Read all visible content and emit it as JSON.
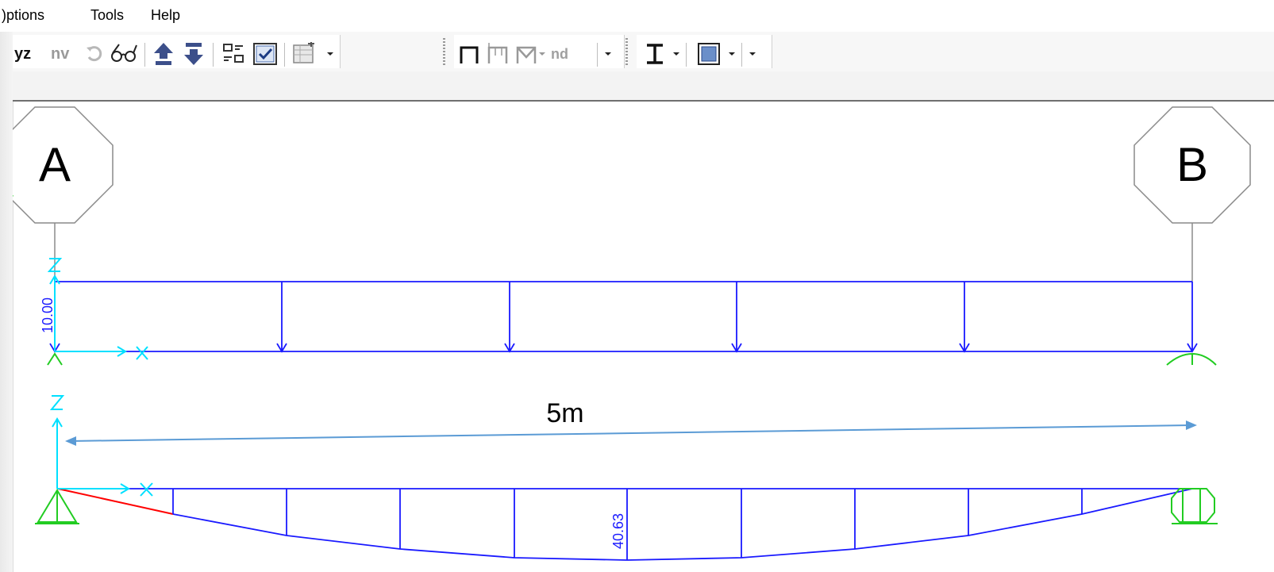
{
  "menu": {
    "options": ")ptions",
    "tools": "Tools",
    "help": "Help"
  },
  "toolbar": {
    "yz_label": "yz",
    "nv_label": "nv",
    "nd_label": "nd",
    "icons": [
      "rotate-icon",
      "glasses-icon",
      "arrow-up-icon",
      "arrow-down-icon",
      "grid-select-icon",
      "checkbox-icon",
      "table-icon",
      "frame-section-icon",
      "frame-hinge-icon",
      "frame-truss-icon",
      "i-beam-icon",
      "area-section-icon"
    ]
  },
  "model": {
    "grid_a": "A",
    "grid_b": "B",
    "load_value": "10.00",
    "span_label": "5m",
    "moment_value": "40.63",
    "axis_z": "Z",
    "axis_x": "X"
  },
  "colors": {
    "load": "#1a1aff",
    "axes": "#00e0ff",
    "support": "#22cc22",
    "grid_bubble": "#808080",
    "dimension": "#5b9bd5",
    "hinge": "#ff0000"
  }
}
